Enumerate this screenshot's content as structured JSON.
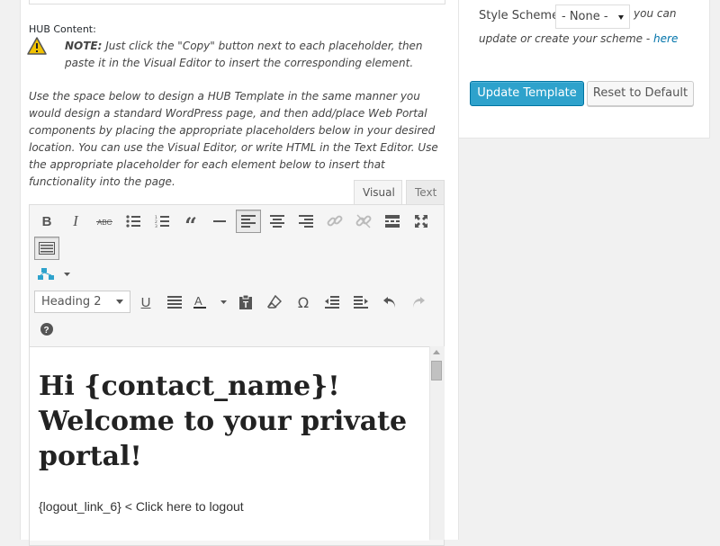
{
  "hub": {
    "label": "HUB Content:",
    "note_bold": "NOTE:",
    "note_text": " Just click the \"Copy\" button next to each placeholder, then paste it in the Visual Editor to insert the corresponding element.",
    "intro": "Use the space below to design a HUB Template in the same manner you would design a standard WordPress page, and then add/place Web Portal components by placing the appropriate placeholders below in your desired location. You can use the Visual Editor, or write HTML in the Text Editor. Use the appropriate placeholder for each element below to insert that functionality into the page."
  },
  "editor": {
    "tabs": {
      "visual": "Visual",
      "text": "Text"
    },
    "format_select": "Heading 2",
    "toolbar_row1": [
      "bold-icon",
      "italic-icon",
      "strikethrough-icon",
      "bullet-list-icon",
      "numbered-list-icon",
      "blockquote-icon",
      "horizontal-rule-icon",
      "align-left-icon",
      "align-center-icon",
      "align-right-icon",
      "link-icon",
      "unlink-icon",
      "read-more-icon",
      "fullscreen-icon",
      "toolbar-toggle-icon"
    ],
    "toolbar_row2": [
      "underline-icon",
      "justify-icon",
      "text-color-icon",
      "paste-text-icon",
      "clear-format-icon",
      "special-char-icon",
      "outdent-icon",
      "indent-icon",
      "undo-icon",
      "redo-icon",
      "help-icon"
    ],
    "content": {
      "heading": "Hi {contact_name}! Welcome to your private portal!",
      "paragraph": "{logout_link_6} < Click here to logout"
    }
  },
  "sidebar": {
    "style_label": "Style Scheme",
    "style_value": "- None -",
    "help_1": "you can",
    "help_2": "update or create your scheme -",
    "help_link": "here",
    "update_button": "Update Template",
    "reset_button": "Reset to Default"
  },
  "colors": {
    "primary": "#2ea2cc",
    "link": "#0073aa",
    "warning": "#f2c200"
  }
}
